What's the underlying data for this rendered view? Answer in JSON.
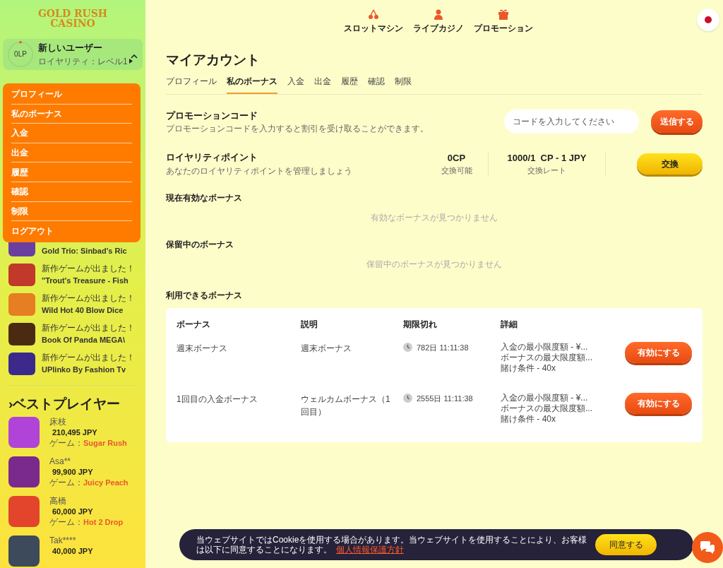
{
  "logo": [
    "GOLD RUSH",
    "CASINO"
  ],
  "user": {
    "points": "0LP",
    "name": "新しいユーザー",
    "loyalty": "ロイヤリティ：レベル1",
    "expanded": true
  },
  "account_menu": [
    "プロフィール",
    "私のボーナス",
    "入金",
    "出金",
    "履歴",
    "確認",
    "制限",
    "ログアウト"
  ],
  "new_games": [
    {
      "title": "Gold Trio: Sinbad's Ric"
    },
    {
      "headline": "新作ゲームが出ました！",
      "title": "\"Trout's Treasure - Fish"
    },
    {
      "headline": "新作ゲームが出ました！",
      "title": "Wild Hot 40 Blow Dice"
    },
    {
      "headline": "新作ゲームが出ました！",
      "title": "Book Of Panda MEGA\\"
    },
    {
      "headline": "新作ゲームが出ました！",
      "title": "UPlinko By Fashion Tv"
    }
  ],
  "best_players": {
    "title": "›ベストプレイヤー",
    "players": [
      {
        "name": "床枝",
        "amount": "210,495 JPY",
        "game_label": "ゲーム：",
        "game": "Sugar Rush"
      },
      {
        "name": "Asa**",
        "amount": "99,900 JPY",
        "game_label": "ゲーム：",
        "game": "Juicy Peach"
      },
      {
        "name": "高橋",
        "amount": "60,000 JPY",
        "game_label": "ゲーム：",
        "game": "Hot 2 Drop"
      },
      {
        "name": "Tak****",
        "amount": "40,000 JPY"
      }
    ]
  },
  "top_nav": [
    {
      "kind": "cherry",
      "label": "スロットマシン"
    },
    {
      "kind": "dealer",
      "label": "ライブカジノ"
    },
    {
      "kind": "gift",
      "label": "プロモーション"
    }
  ],
  "page_title": "マイアカウント",
  "tabs": [
    {
      "label": "プロフィール",
      "selected": false
    },
    {
      "label": "私のボーナス",
      "selected": true
    },
    {
      "label": "入金",
      "selected": false
    },
    {
      "label": "出金",
      "selected": false
    },
    {
      "label": "履歴",
      "selected": false
    },
    {
      "label": "確認",
      "selected": false
    },
    {
      "label": "制限",
      "selected": false
    }
  ],
  "promo_code": {
    "title": "プロモーションコード",
    "description": "プロモーションコードを入力すると割引を受け取ることができます。",
    "placeholder": "コードを入力してください",
    "button": "送信する"
  },
  "loyalty_points": {
    "title": "ロイヤリティポイント",
    "description": "あなたのロイヤリティポイントを管理しましょう",
    "points": "0CP",
    "points_label": "交換可能",
    "rate": "1000/1  CP - 1 JPY",
    "rate_label": "交換レート",
    "button": "交換"
  },
  "active_bonuses": {
    "title": "現在有効なボーナス",
    "empty": "有効なボーナスが見つかりません"
  },
  "pending_bonuses": {
    "title": "保留中のボーナス",
    "empty": "保留中のボーナスが見つかりません"
  },
  "available_bonuses": {
    "title": "利用できるボーナス",
    "columns": [
      "ボーナス",
      "説明",
      "期限切れ",
      "詳細"
    ],
    "rows": [
      {
        "bonus": "週末ボーナス",
        "description": "週末ボーナス",
        "expires": "782日 11:11:38",
        "details": [
          "入金の最小限度額 - ¥...",
          "ボーナスの最大限度額...",
          "賭け条件 - 40x"
        ],
        "button": "有効にする"
      },
      {
        "bonus": "1回目の入金ボーナス",
        "description": "ウェルカムボーナス（1回目）",
        "expires": "2555日 11:11:38",
        "details": [
          "入金の最小限度額 - ¥...",
          "ボーナスの最大限度額...",
          "賭け条件 - 40x"
        ],
        "button": "有効にする"
      }
    ]
  },
  "cookie_banner": {
    "text": "当ウェブサイトではCookieを使用する場合があります。当ウェブサイトを使用することにより、お客様は以下に同意することになります。",
    "link": "個人情報保護方針",
    "button": "同意する"
  }
}
